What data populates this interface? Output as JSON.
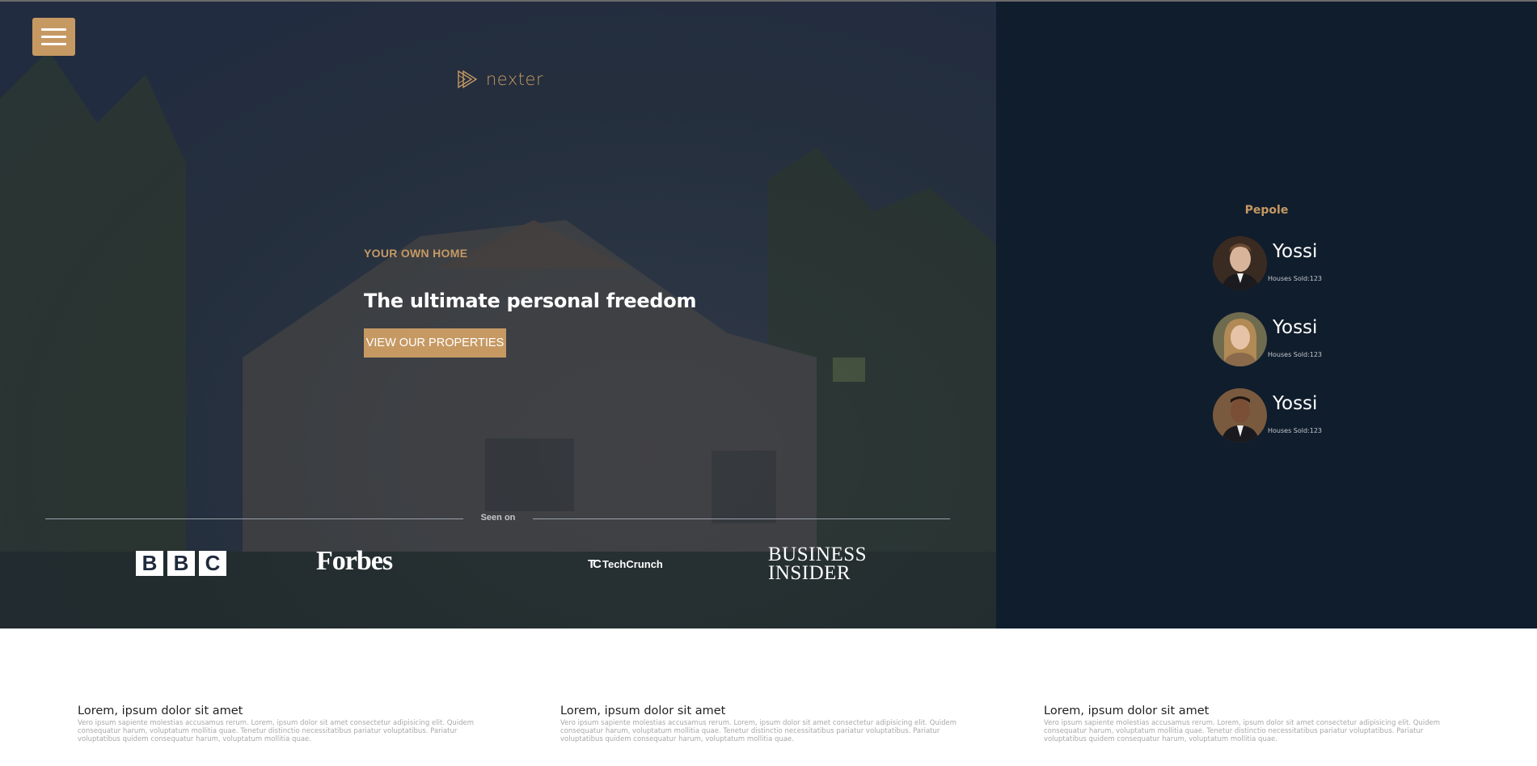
{
  "menu": {
    "icon": "hamburger-menu-icon"
  },
  "logo": {
    "text": "nexter",
    "icon": "triangle-logo-icon"
  },
  "hero": {
    "subtitle": "YOUR OWN HOME",
    "title": "The ultimate personal freedom",
    "button_label": "VIEW OUR PROPERTIES"
  },
  "seen_on": {
    "label": "Seen on",
    "logos": {
      "bbc": [
        "B",
        "B",
        "C"
      ],
      "forbes": "Forbes",
      "techcrunch_mark": "TC",
      "techcrunch": "TechCrunch",
      "business_insider_1": "Business",
      "business_insider_2": "Insider"
    }
  },
  "people": {
    "title": "Pepole",
    "items": [
      {
        "name": "Yossi",
        "sold": "Houses Sold:123"
      },
      {
        "name": "Yossi",
        "sold": "Houses Sold:123"
      },
      {
        "name": "Yossi",
        "sold": "Houses Sold:123"
      }
    ]
  },
  "features": [
    {
      "title": "Lorem, ipsum dolor sit amet",
      "text": "Vero ipsum sapiente molestias accusamus rerum. Lorem, ipsum dolor sit amet consectetur adipisicing elit. Quidem consequatur harum, voluptatum mollitia quae. Tenetur distinctio necessitatibus pariatur voluptatibus. Pariatur voluptatibus quidem consequatur harum, voluptatum mollitia quae."
    },
    {
      "title": "Lorem, ipsum dolor sit amet",
      "text": "Vero ipsum sapiente molestias accusamus rerum. Lorem, ipsum dolor sit amet consectetur adipisicing elit. Quidem consequatur harum, voluptatum mollitia quae. Tenetur distinctio necessitatibus pariatur voluptatibus. Pariatur voluptatibus quidem consequatur harum, voluptatum mollitia quae."
    },
    {
      "title": "Lorem, ipsum dolor sit amet",
      "text": "Vero ipsum sapiente molestias accusamus rerum. Lorem, ipsum dolor sit amet consectetur adipisicing elit. Quidem consequatur harum, voluptatum mollitia quae. Tenetur distinctio necessitatibus pariatur voluptatibus. Pariatur voluptatibus quidem consequatur harum, voluptatum mollitia quae."
    }
  ],
  "colors": {
    "accent": "#c69963",
    "sidebar": "#101d2c",
    "hero_overlay": "#242e44"
  }
}
